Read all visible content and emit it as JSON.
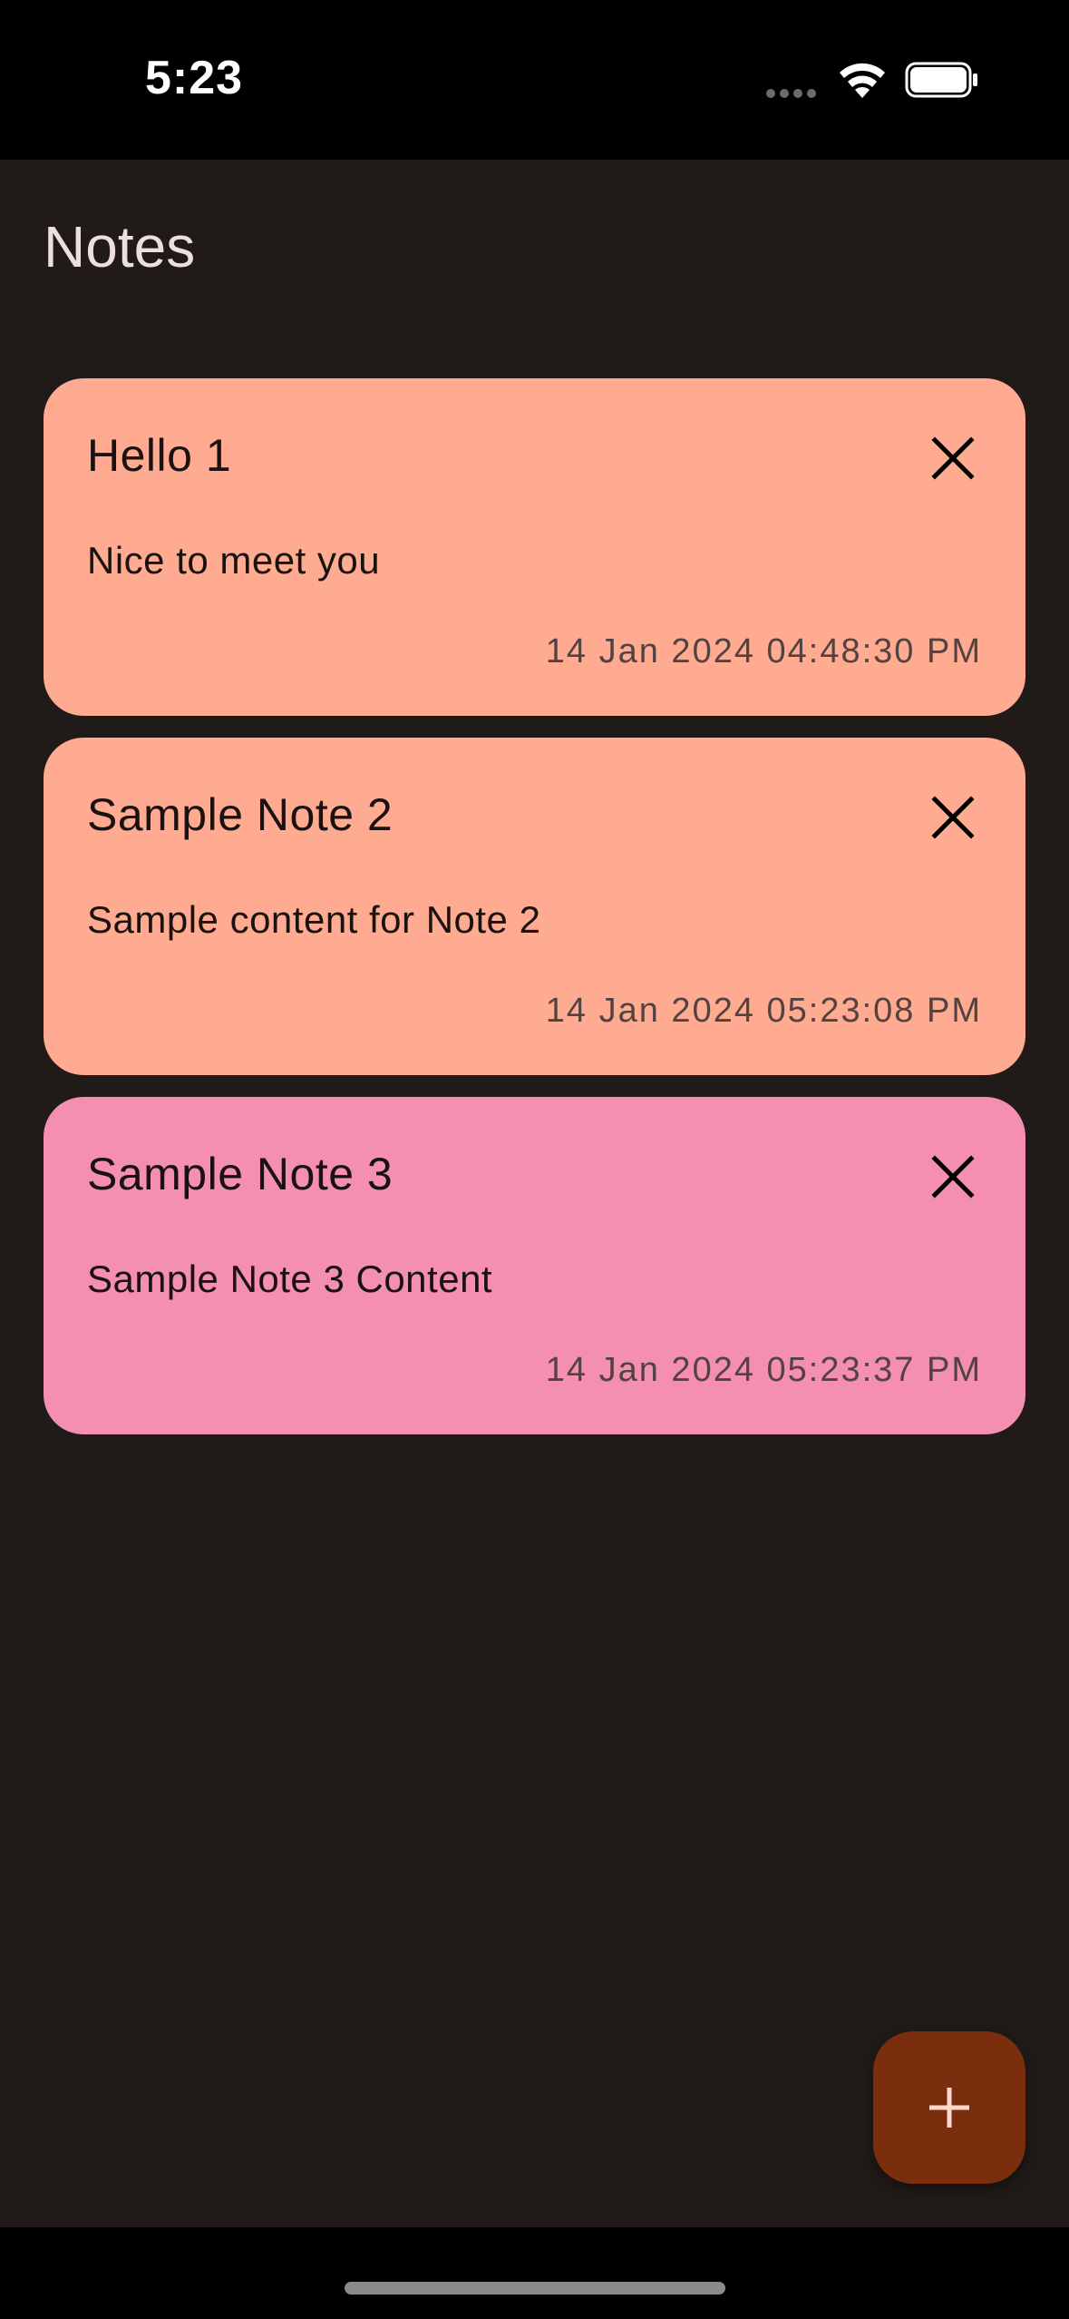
{
  "status_bar": {
    "time": "5:23"
  },
  "app": {
    "title": "Notes"
  },
  "notes": [
    {
      "title": "Hello 1",
      "content": "Nice to meet you",
      "date": "14 Jan 2024 04:48:30 PM",
      "color": "#ffab91"
    },
    {
      "title": "Sample Note 2",
      "content": "Sample content for Note 2",
      "date": "14 Jan 2024 05:23:08 PM",
      "color": "#ffab91"
    },
    {
      "title": "Sample Note 3",
      "content": "Sample Note 3 Content",
      "date": "14 Jan 2024 05:23:37 PM",
      "color": "#f48fb1"
    }
  ],
  "icons": {
    "delete": "close-icon",
    "add": "plus-icon"
  },
  "colors": {
    "background": "#201a18",
    "fab": "#7a2e0e",
    "title_text": "#ede0dc"
  }
}
